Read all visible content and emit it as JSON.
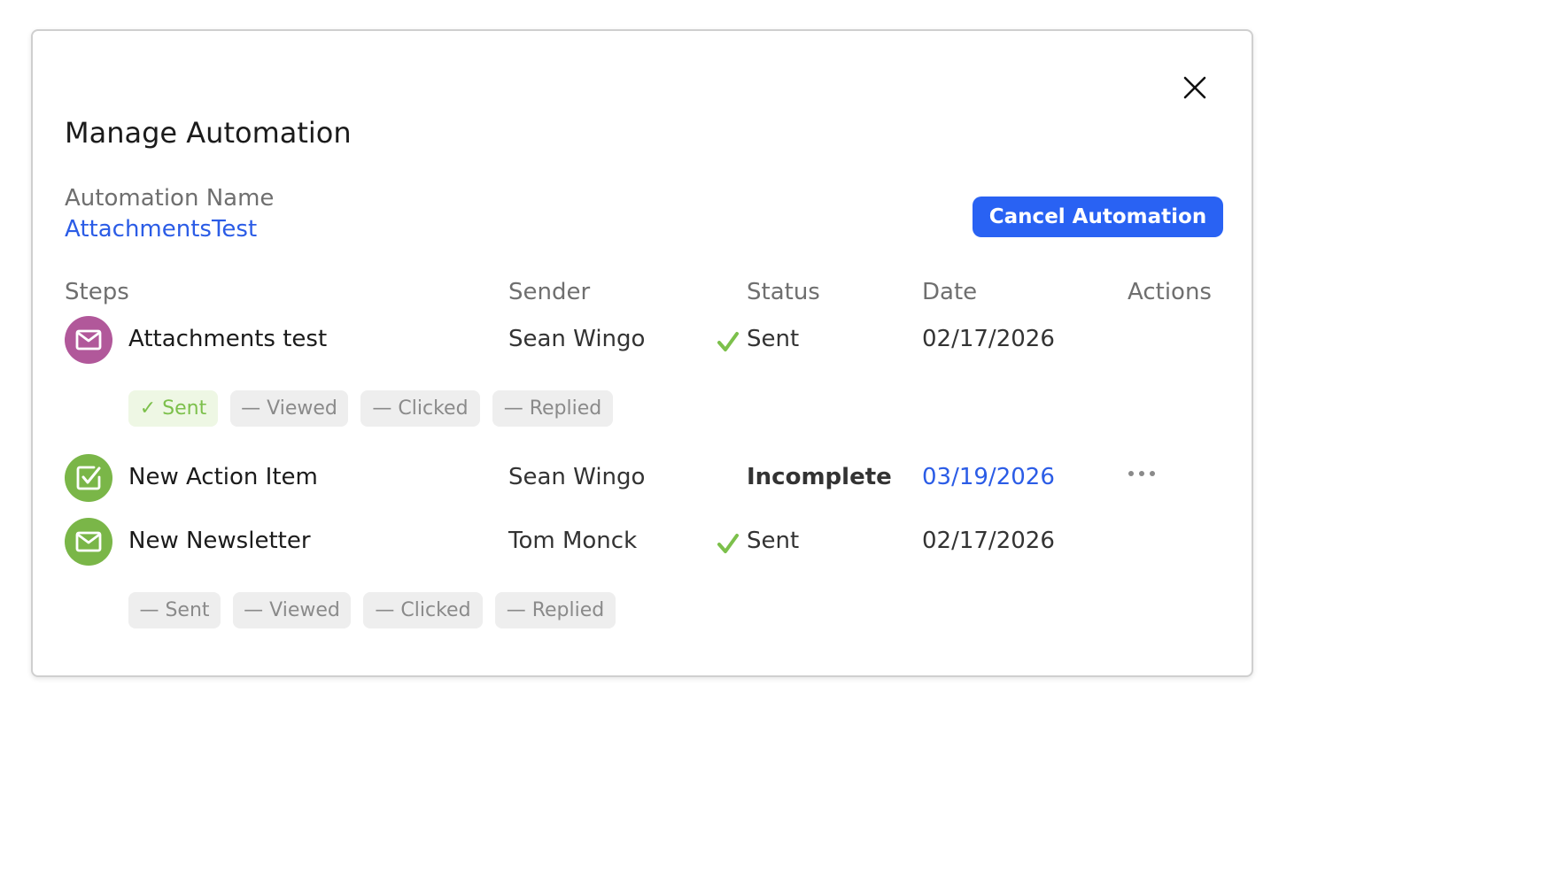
{
  "modal": {
    "title": "Manage Automation",
    "close_icon": "close-icon",
    "automation_name_label": "Automation Name",
    "automation_name_value": "AttachmentsTest",
    "cancel_button": "Cancel Automation"
  },
  "table": {
    "headers": {
      "steps": "Steps",
      "sender": "Sender",
      "status": "Status",
      "date": "Date",
      "actions": "Actions"
    },
    "rows": [
      {
        "icon": "mail-icon",
        "icon_color": "#b1589a",
        "step": "Attachments test",
        "sender": "Sean Wingo",
        "status_icon": "checkmark-icon",
        "status": "Sent",
        "date": "02/17/2026",
        "chips": [
          "✓ Sent",
          "— Viewed",
          "— Clicked",
          "— Replied"
        ]
      },
      {
        "icon": "task-check-icon",
        "icon_color": "#7ab648",
        "step": "New Action Item",
        "sender": "Sean Wingo",
        "status": "Incomplete",
        "date": "03/19/2026",
        "action_icon": "more-horizontal-icon"
      },
      {
        "icon": "mail-icon",
        "icon_color": "#7ab648",
        "step": "New Newsletter",
        "sender": "Tom Monck",
        "status_icon": "checkmark-icon",
        "status": "Sent",
        "date": "02/17/2026",
        "chips": [
          "— Sent",
          "— Viewed",
          "— Clicked",
          "— Replied"
        ]
      }
    ]
  },
  "colors": {
    "accent": "#2962f3",
    "link": "#2b5ce6",
    "success": "#7cc04b"
  }
}
